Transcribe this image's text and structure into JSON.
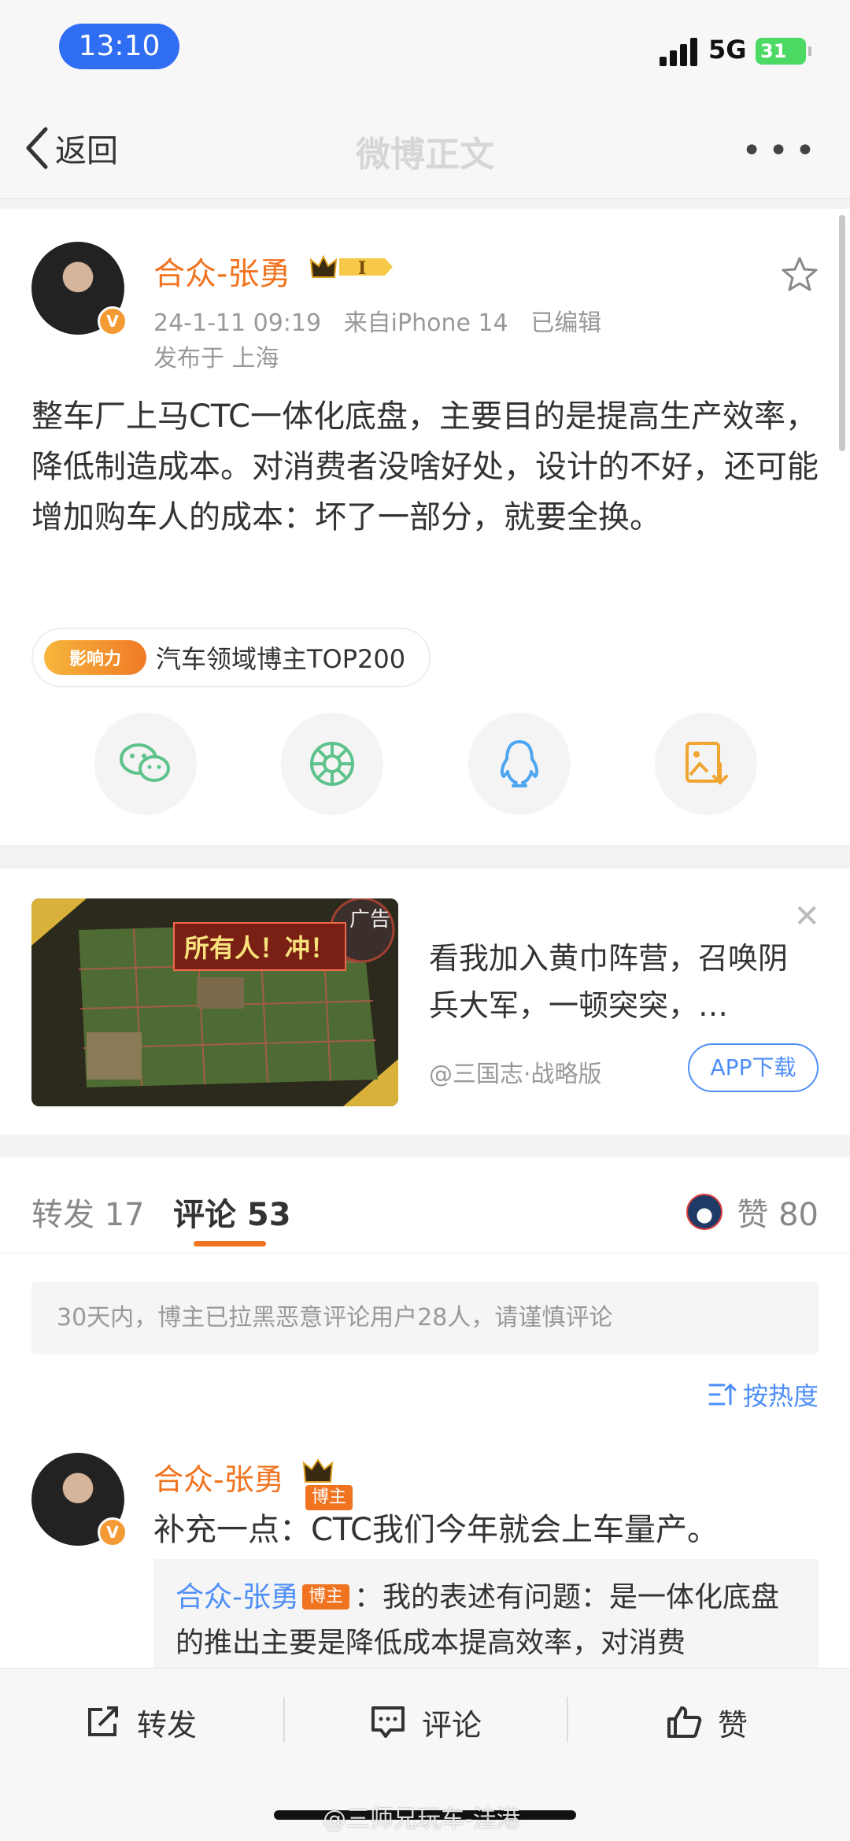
{
  "status_bar": {
    "time": "13:10",
    "network": "5G",
    "battery": "31"
  },
  "nav": {
    "back_label": "返回",
    "title": "微博正文"
  },
  "post": {
    "author": "合众-张勇",
    "vip_level": "I",
    "time": "24-1-11 09:19",
    "source": "来自iPhone 14",
    "edited": "已编辑",
    "location": "发布于 上海",
    "body": "整车厂上马CTC一体化底盘，主要目的是提高生产效率，降低制造成本。对消费者没啥好处，设计的不好，还可能增加购车人的成本：坏了一部分，就要全换。",
    "badge_logo": "影响力",
    "badge_text": "汽车领域博主TOP200"
  },
  "ad": {
    "label": "广告",
    "banner": "所有人！冲！",
    "text": "看我加入黄巾阵营，召唤阴兵大军，一顿突突，…",
    "source": "@三国志·战略版",
    "button": "APP下载"
  },
  "tabs": {
    "repost": "转发 17",
    "comment": "评论 53",
    "likes": "赞 80"
  },
  "notice": "30天内，博主已拉黑恶意评论用户28人，请谨慎评论",
  "sort_label": "按热度",
  "comment": {
    "author": "合众-张勇",
    "tag": "博主",
    "text": "补充一点：CTC我们今年就会上车量产。",
    "reply_author": "合众-张勇",
    "reply_tag": "博主",
    "reply_text": "：我的表述有问题：是一体化底盘的推出主要是降低成本提高效率，对消费"
  },
  "bottom_bar": {
    "repost": "转发",
    "comment": "评论",
    "like": "赞"
  },
  "watermark": "@三师兄玩车-洼港",
  "colors": {
    "accent_orange": "#f0731f",
    "link_blue": "#4e8ff7",
    "time_pill": "#2f6df2"
  }
}
